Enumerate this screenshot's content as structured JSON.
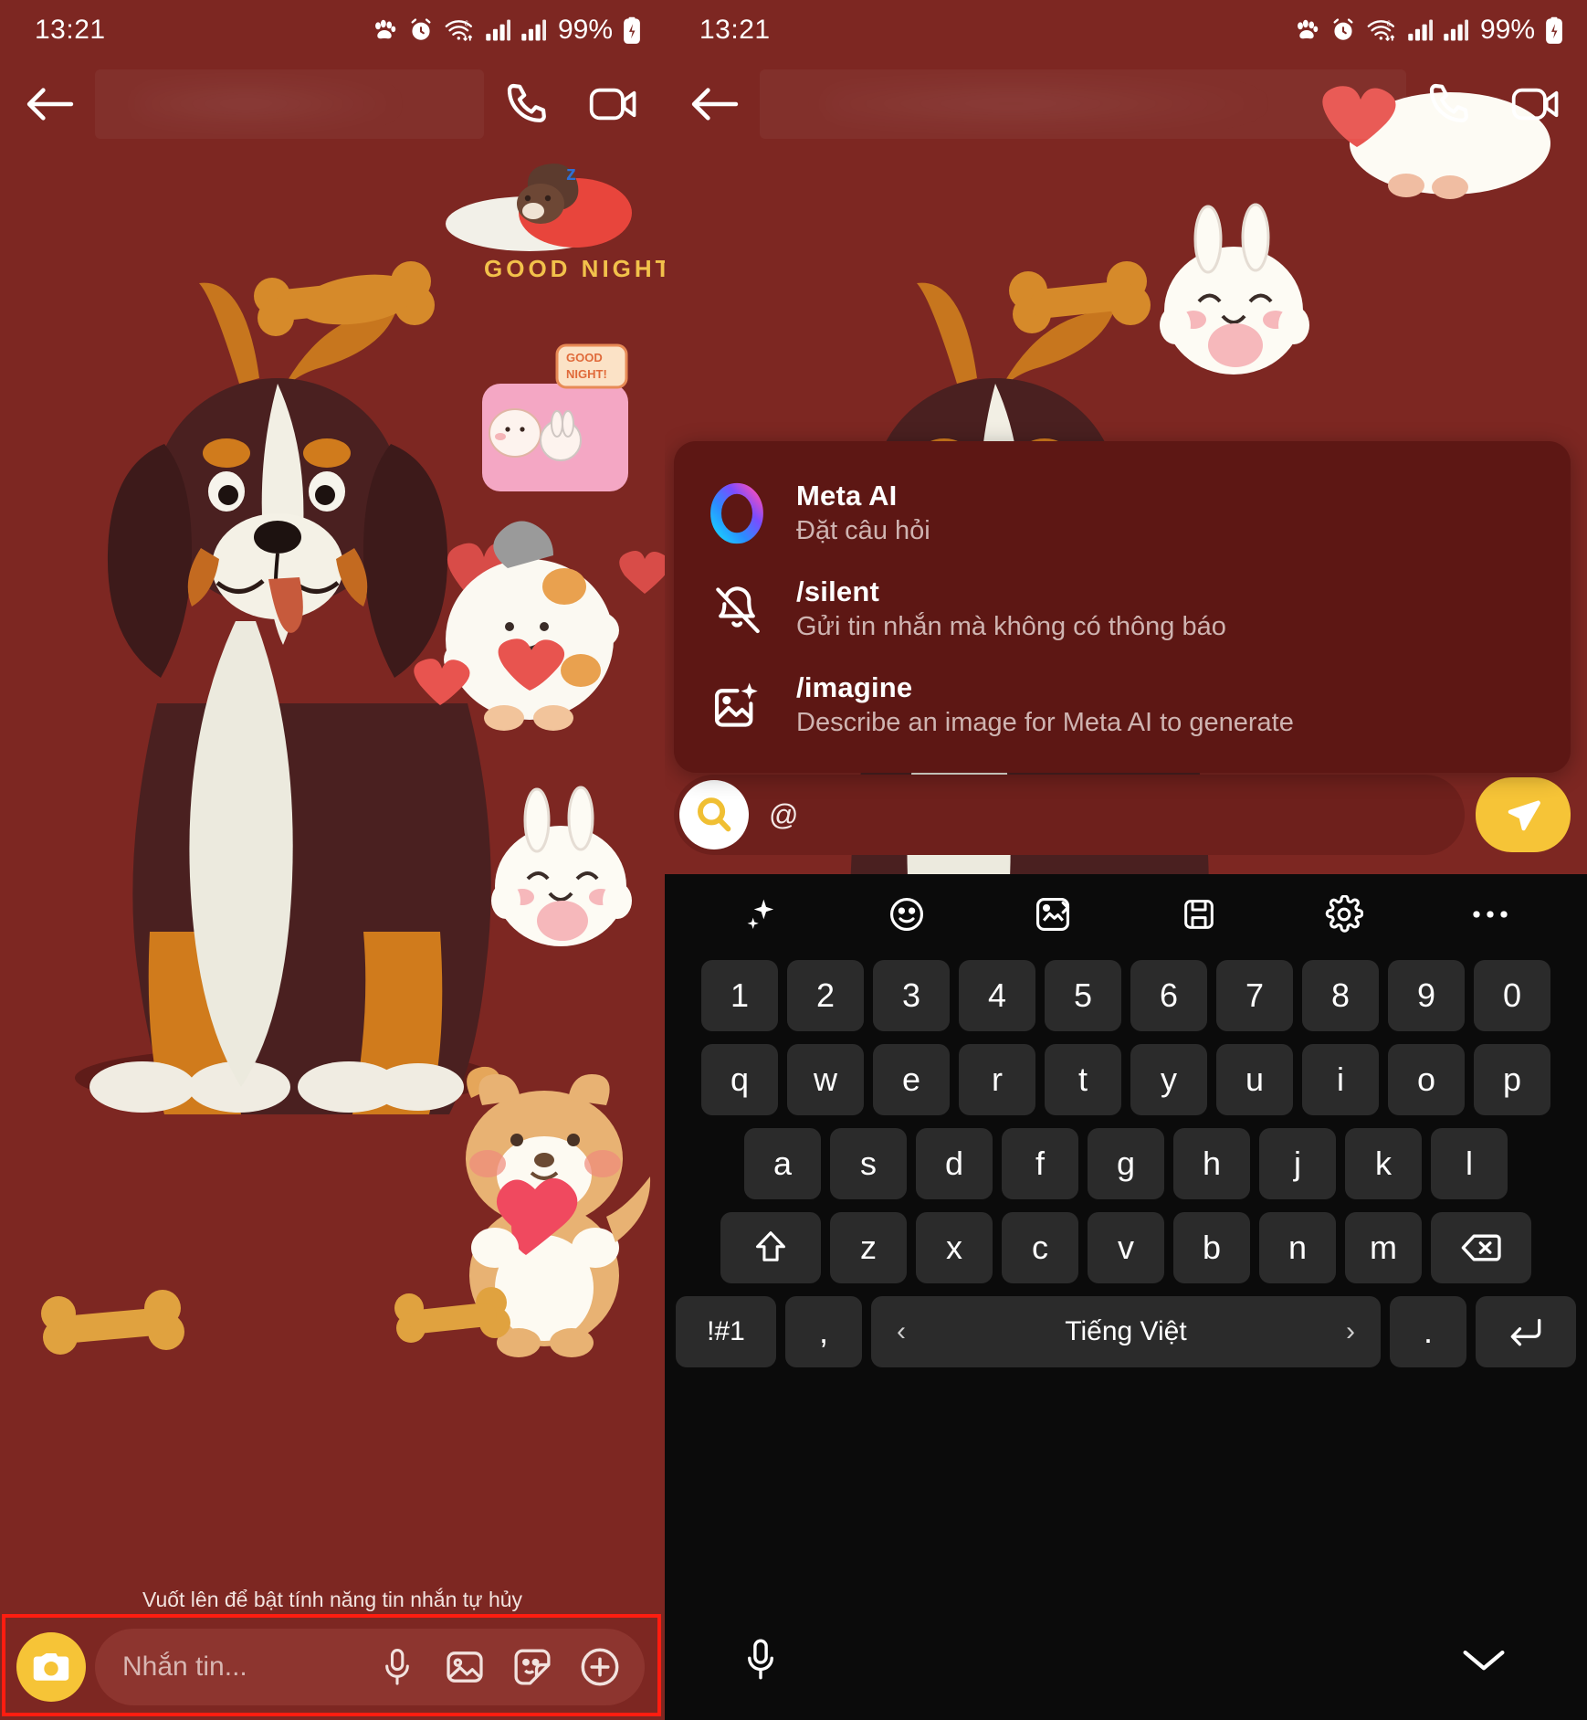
{
  "theme": {
    "chat_bg": "#7d2722",
    "accent_yellow": "#f6c437",
    "menu_bg": "#5d1714",
    "keyboard_bg": "#0b0b0b",
    "key_bg": "#2b2b2b",
    "highlight_outline": "#ff1d10"
  },
  "left_panel": {
    "status": {
      "time": "13:21",
      "battery": "99%",
      "icons": [
        "paw-icon",
        "alarm-icon",
        "wifi-icon",
        "signal-icon",
        "signal-icon",
        "battery-icon"
      ]
    },
    "header": {
      "back_icon": "back-arrow-icon",
      "contact_name": "",
      "call_icon": "phone-call-icon",
      "video_icon": "video-call-icon"
    },
    "ephemeral_hint": "Vuốt lên để bật tính năng tin nhắn tự hủy",
    "compose": {
      "camera_icon": "camera-icon",
      "placeholder": "Nhắn tin...",
      "icons": [
        "microphone-icon",
        "gallery-icon",
        "sticker-icon",
        "plus-icon"
      ]
    }
  },
  "right_panel": {
    "status": {
      "time": "13:21",
      "battery": "99%"
    },
    "header": {
      "back_icon": "back-arrow-icon",
      "contact_name": "",
      "call_icon": "phone-call-icon",
      "video_icon": "video-call-icon"
    },
    "ai_menu": {
      "items": [
        {
          "icon": "meta-ai-ring-icon",
          "title": "Meta AI",
          "subtitle": "Đặt câu hỏi"
        },
        {
          "icon": "bell-off-icon",
          "title": "/silent",
          "subtitle": "Gửi tin nhắn mà không có thông báo"
        },
        {
          "icon": "image-sparkle-icon",
          "title": "/imagine",
          "subtitle": "Describe an image for Meta AI to generate"
        }
      ]
    },
    "input_bar": {
      "search_icon": "search-icon",
      "value": "@",
      "send_icon": "send-icon"
    },
    "keyboard": {
      "toolbar": [
        "sparkle-icon",
        "emoji-icon",
        "image-translate-icon",
        "clipboard-icon",
        "gear-icon",
        "more-icon"
      ],
      "rows": [
        [
          "1",
          "2",
          "3",
          "4",
          "5",
          "6",
          "7",
          "8",
          "9",
          "0"
        ],
        [
          "q",
          "w",
          "e",
          "r",
          "t",
          "y",
          "u",
          "i",
          "o",
          "p"
        ],
        [
          "a",
          "s",
          "d",
          "f",
          "g",
          "h",
          "j",
          "k",
          "l"
        ],
        [
          "z",
          "x",
          "c",
          "v",
          "b",
          "n",
          "m"
        ]
      ],
      "shift_key": "shift-icon",
      "backspace_key": "backspace-icon",
      "symbols_key": "!#1",
      "comma_key": ",",
      "space_label": "Tiếng Việt",
      "space_prev": "‹",
      "space_next": "›",
      "period_key": ".",
      "enter_key": "enter-icon",
      "mic_icon": "microphone-icon",
      "hide_icon": "chevron-down-icon"
    }
  }
}
